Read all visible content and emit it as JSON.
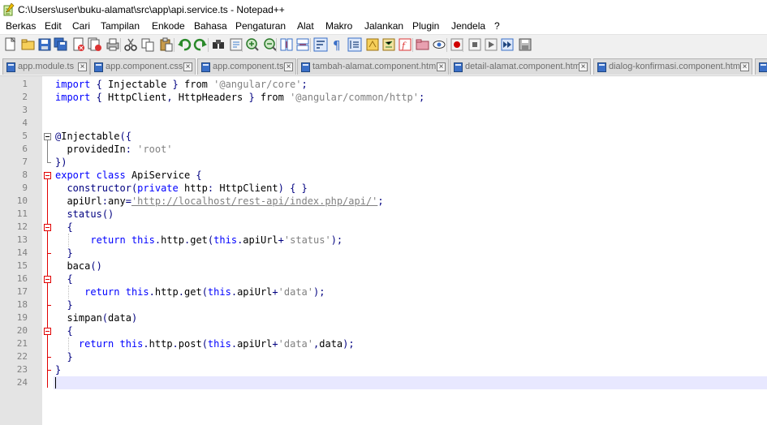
{
  "window": {
    "title": "C:\\Users\\user\\buku-alamat\\src\\app\\api.service.ts - Notepad++"
  },
  "menu": [
    "Berkas",
    "Edit",
    "Cari",
    "Tampilan",
    "Enkode",
    "Bahasa",
    "Pengaturan",
    "Alat",
    "Makro",
    "Jalankan",
    "Plugin",
    "Jendela",
    "?"
  ],
  "toolbar": {
    "icons": [
      "new-file-icon",
      "open-file-icon",
      "save-icon",
      "save-all-icon",
      "close-icon",
      "close-all-icon",
      "print-icon",
      "cut-icon",
      "copy-icon",
      "paste-icon",
      "undo-icon",
      "redo-icon",
      "find-icon",
      "replace-icon",
      "zoom-in-icon",
      "zoom-out-icon",
      "sync-vertical-icon",
      "sync-horizontal-icon",
      "word-wrap-icon",
      "show-all-characters-icon",
      "indent-guide-icon",
      "user-defined-language-icon",
      "document-map-icon",
      "function-list-icon",
      "folder-as-workspace-icon",
      "monitoring-icon",
      "record-macro-icon",
      "stop-recording-icon",
      "playback-macro-icon",
      "run-macro-multiple-icon",
      "save-macro-icon"
    ]
  },
  "tabs": [
    {
      "label": "app.module.ts"
    },
    {
      "label": "app.component.css"
    },
    {
      "label": "app.component.ts"
    },
    {
      "label": "tambah-alamat.component.html"
    },
    {
      "label": "detail-alamat.component.html"
    },
    {
      "label": "dialog-konfirmasi.component.html"
    }
  ],
  "editor": {
    "lines": [
      {
        "n": "1",
        "tokens": [
          [
            "kw",
            "import"
          ],
          [
            "df",
            " "
          ],
          [
            "op",
            "{"
          ],
          [
            "df",
            " Injectable "
          ],
          [
            "op",
            "}"
          ],
          [
            "df",
            " from "
          ],
          [
            "st",
            "'@angular/core'"
          ],
          [
            "op",
            ";"
          ]
        ]
      },
      {
        "n": "2",
        "tokens": [
          [
            "kw",
            "import"
          ],
          [
            "df",
            " "
          ],
          [
            "op",
            "{"
          ],
          [
            "df",
            " HttpClient"
          ],
          [
            "op",
            ","
          ],
          [
            "df",
            " HttpHeaders "
          ],
          [
            "op",
            "}"
          ],
          [
            "df",
            " from "
          ],
          [
            "st",
            "'@angular/common/http'"
          ],
          [
            "op",
            ";"
          ]
        ]
      },
      {
        "n": "3",
        "tokens": []
      },
      {
        "n": "4",
        "tokens": []
      },
      {
        "n": "5",
        "tokens": [
          [
            "op",
            "@"
          ],
          [
            "df",
            "Injectable"
          ],
          [
            "op",
            "({"
          ]
        ]
      },
      {
        "n": "6",
        "tokens": [
          [
            "df",
            "  providedIn"
          ],
          [
            "op",
            ":"
          ],
          [
            "df",
            " "
          ],
          [
            "st",
            "'root'"
          ]
        ]
      },
      {
        "n": "7",
        "tokens": [
          [
            "op",
            "})"
          ]
        ]
      },
      {
        "n": "8",
        "tokens": [
          [
            "kw",
            "export"
          ],
          [
            "df",
            " "
          ],
          [
            "kw",
            "class"
          ],
          [
            "df",
            " ApiService "
          ],
          [
            "op",
            "{"
          ]
        ]
      },
      {
        "n": "9",
        "tokens": [
          [
            "df",
            "  "
          ],
          [
            "ty",
            "constructor"
          ],
          [
            "op",
            "("
          ],
          [
            "kw",
            "private"
          ],
          [
            "df",
            " http"
          ],
          [
            "op",
            ":"
          ],
          [
            "df",
            " HttpClient"
          ],
          [
            "op",
            ")"
          ],
          [
            "df",
            " "
          ],
          [
            "op",
            "{"
          ],
          [
            "df",
            " "
          ],
          [
            "op",
            "}"
          ]
        ]
      },
      {
        "n": "10",
        "tokens": [
          [
            "df",
            "  apiUrl"
          ],
          [
            "op",
            ":"
          ],
          [
            "df",
            "any"
          ],
          [
            "op",
            "="
          ],
          [
            "url",
            "'http://localhost/rest-api/index.php/api/'"
          ],
          [
            "op",
            ";"
          ]
        ]
      },
      {
        "n": "11",
        "tokens": [
          [
            "df",
            "  "
          ],
          [
            "ty",
            "status"
          ],
          [
            "op",
            "()"
          ]
        ]
      },
      {
        "n": "12",
        "tokens": [
          [
            "df",
            "  "
          ],
          [
            "op",
            "{"
          ]
        ]
      },
      {
        "n": "13",
        "tokens": [
          [
            "df",
            "      "
          ],
          [
            "kw",
            "return"
          ],
          [
            "df",
            " "
          ],
          [
            "kw",
            "this"
          ],
          [
            "op",
            "."
          ],
          [
            "df",
            "http"
          ],
          [
            "op",
            "."
          ],
          [
            "df",
            "get"
          ],
          [
            "op",
            "("
          ],
          [
            "kw",
            "this"
          ],
          [
            "op",
            "."
          ],
          [
            "df",
            "apiUrl"
          ],
          [
            "op",
            "+"
          ],
          [
            "st",
            "'status'"
          ],
          [
            "op",
            ");"
          ]
        ]
      },
      {
        "n": "14",
        "tokens": [
          [
            "df",
            "  "
          ],
          [
            "op",
            "}"
          ]
        ]
      },
      {
        "n": "15",
        "tokens": [
          [
            "df",
            "  baca"
          ],
          [
            "op",
            "()"
          ]
        ]
      },
      {
        "n": "16",
        "tokens": [
          [
            "df",
            "  "
          ],
          [
            "op",
            "{"
          ]
        ]
      },
      {
        "n": "17",
        "tokens": [
          [
            "df",
            "     "
          ],
          [
            "kw",
            "return"
          ],
          [
            "df",
            " "
          ],
          [
            "kw",
            "this"
          ],
          [
            "op",
            "."
          ],
          [
            "df",
            "http"
          ],
          [
            "op",
            "."
          ],
          [
            "df",
            "get"
          ],
          [
            "op",
            "("
          ],
          [
            "kw",
            "this"
          ],
          [
            "op",
            "."
          ],
          [
            "df",
            "apiUrl"
          ],
          [
            "op",
            "+"
          ],
          [
            "st",
            "'data'"
          ],
          [
            "op",
            ");"
          ]
        ]
      },
      {
        "n": "18",
        "tokens": [
          [
            "df",
            "  "
          ],
          [
            "op",
            "}"
          ]
        ]
      },
      {
        "n": "19",
        "tokens": [
          [
            "df",
            "  simpan"
          ],
          [
            "op",
            "("
          ],
          [
            "df",
            "data"
          ],
          [
            "op",
            ")"
          ]
        ]
      },
      {
        "n": "20",
        "tokens": [
          [
            "df",
            "  "
          ],
          [
            "op",
            "{"
          ]
        ]
      },
      {
        "n": "21",
        "tokens": [
          [
            "df",
            "    "
          ],
          [
            "kw",
            "return"
          ],
          [
            "df",
            " "
          ],
          [
            "kw",
            "this"
          ],
          [
            "op",
            "."
          ],
          [
            "df",
            "http"
          ],
          [
            "op",
            "."
          ],
          [
            "df",
            "post"
          ],
          [
            "op",
            "("
          ],
          [
            "kw",
            "this"
          ],
          [
            "op",
            "."
          ],
          [
            "df",
            "apiUrl"
          ],
          [
            "op",
            "+"
          ],
          [
            "st",
            "'data'"
          ],
          [
            "op",
            ","
          ],
          [
            "df",
            "data"
          ],
          [
            "op",
            ");"
          ]
        ]
      },
      {
        "n": "22",
        "tokens": [
          [
            "df",
            "  "
          ],
          [
            "op",
            "}"
          ]
        ]
      },
      {
        "n": "23",
        "tokens": [
          [
            "op",
            "}"
          ]
        ]
      },
      {
        "n": "24",
        "tokens": []
      }
    ]
  }
}
